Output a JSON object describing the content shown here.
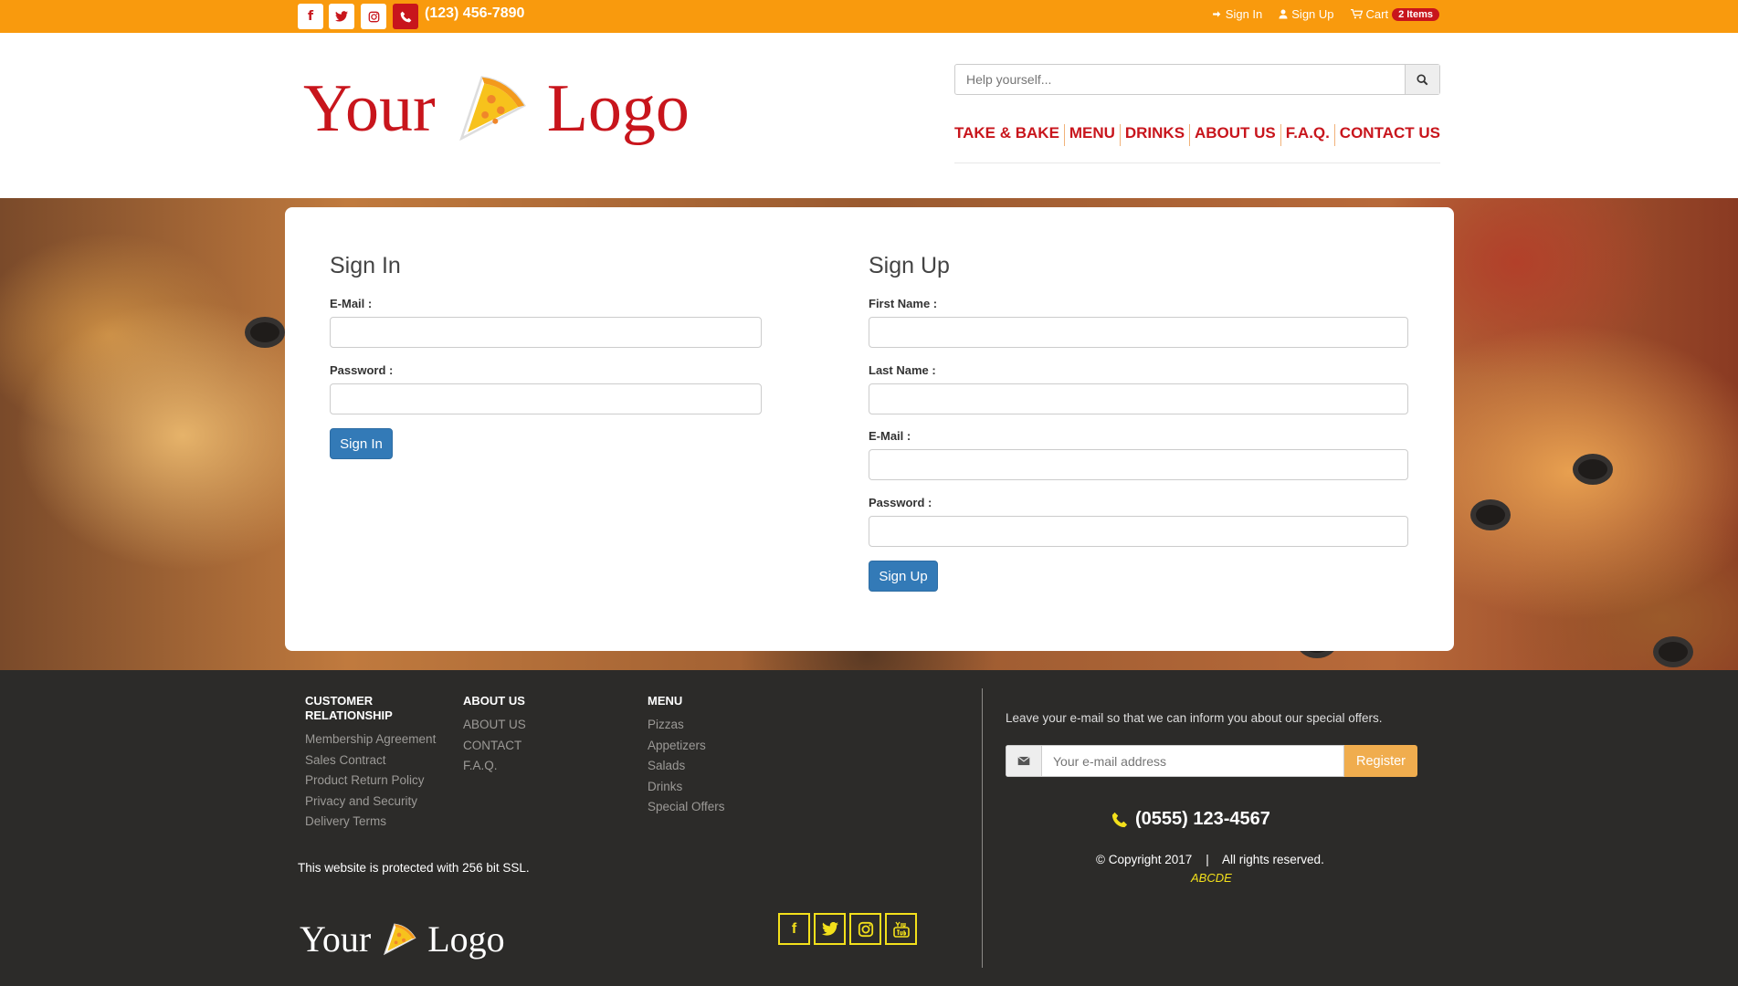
{
  "topbar": {
    "social_icons": [
      "facebook-icon",
      "twitter-icon",
      "instagram-icon",
      "phone-icon"
    ],
    "phone": "(123) 456-7890",
    "links": {
      "signin": "Sign In",
      "signup": "Sign Up",
      "cart": "Cart",
      "cart_badge": "2 Items"
    },
    "colors": {
      "bar": "#f99a0d",
      "accent": "#c8151c"
    }
  },
  "header": {
    "logo_left": "Your",
    "logo_right": "Logo",
    "search_placeholder": "Help yourself...",
    "nav": [
      "TAKE & BAKE",
      "MENU",
      "DRINKS",
      "ABOUT US",
      "F.A.Q.",
      "CONTACT US"
    ]
  },
  "signin": {
    "title": "Sign In",
    "email_label": "E-Mail :",
    "password_label": "Password :",
    "button": "Sign In"
  },
  "signup": {
    "title": "Sign Up",
    "firstname_label": "First Name :",
    "lastname_label": "Last Name :",
    "email_label": "E-Mail :",
    "password_label": "Password :",
    "button": "Sign Up"
  },
  "footer": {
    "col1_title": "CUSTOMER RELATIONSHIP",
    "col1_items": [
      "Membership Agreement",
      "Sales Contract",
      "Product Return Policy",
      "Privacy and Security",
      "Delivery Terms"
    ],
    "col2_title": "ABOUT US",
    "col2_items": [
      "ABOUT US",
      "CONTACT",
      "F.A.Q."
    ],
    "col3_title": "MENU",
    "col3_items": [
      "Pizzas",
      "Appetizers",
      "Salads",
      "Drinks",
      "Special Offers"
    ],
    "ssl_text": "This website is protected with 256 bit SSL.",
    "logo_left": "Your",
    "logo_right": "Logo",
    "social_icons": [
      "facebook-icon",
      "twitter-icon",
      "instagram-icon",
      "youtube-icon"
    ],
    "promo": "Leave your e-mail so that we can inform you about our special offers.",
    "email_placeholder": "Your e-mail address",
    "register": "Register",
    "phone": "(0555) 123-4567",
    "copyright": "© Copyright 2017    |    All rights reserved.",
    "brand": "ABCDE",
    "colors": {
      "background": "#2c2b29",
      "highlight": "#f3e01b",
      "register": "#f0ad4e"
    }
  }
}
